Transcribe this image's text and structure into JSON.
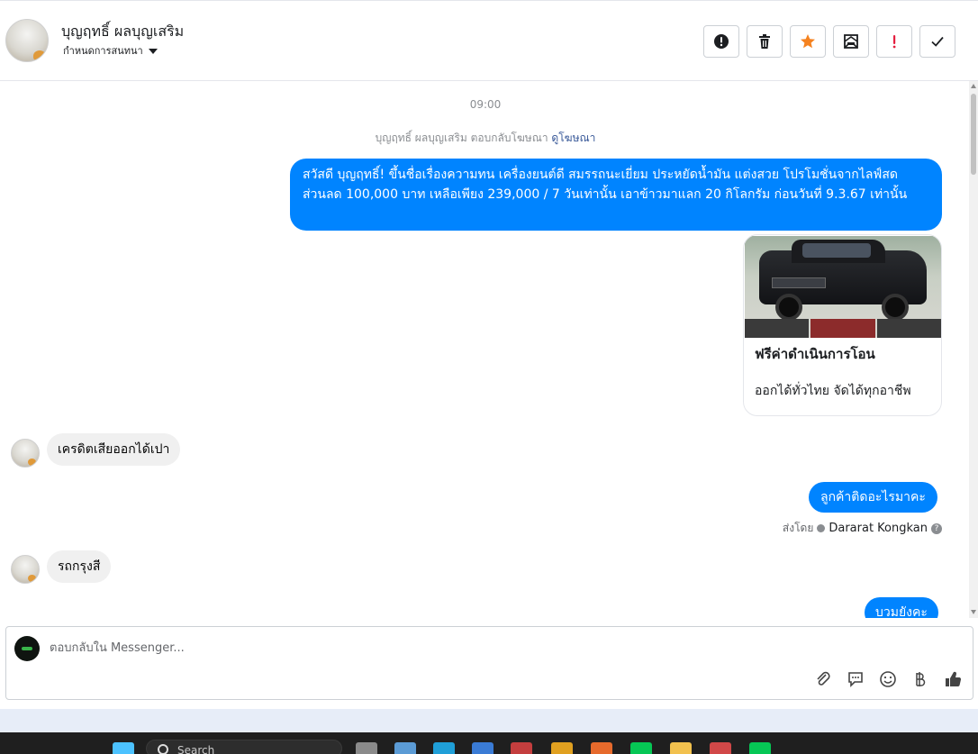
{
  "header": {
    "contact_name": "บุญฤทธิ์ ผลบุญเสริม",
    "assign_label": "กำหนดการสนทนา",
    "toolbar": [
      {
        "name": "spam-button",
        "icon": "alert-circle-icon"
      },
      {
        "name": "delete-button",
        "icon": "trash-icon"
      },
      {
        "name": "star-button",
        "icon": "star-icon",
        "color": "#f5821f"
      },
      {
        "name": "mark-unread-button",
        "icon": "envelope-icon"
      },
      {
        "name": "follow-up-button",
        "icon": "exclamation-icon",
        "color": "#e41e3f"
      },
      {
        "name": "mark-done-button",
        "icon": "check-icon"
      }
    ]
  },
  "conversation": {
    "timestamp": "09:00",
    "ad_reply_prefix": "บุญฤทธิ์ ผลบุญเสริม ตอบกลับโฆษณา",
    "ad_reply_link": "ดูโฆษณา",
    "ad_message": "สวัสดี บุญฤทธิ์! ขึ้นชื่อเรื่องความทน เครื่องยนต์ดี สมรรถนะเยี่ยม ประหยัดน้ำมัน แต่งสวย โปรโมชั่นจากไลฟ์สด ส่วนลด 100,000 บาท เหลือเพียง 239,000 / 7 วันเท่านั้น เอาข้าวมาแลก 20 กิโลกรัม ก่อนวันที่ 9.3.67 เท่านั้น",
    "ad_card": {
      "title": "ฟรีค่าดำเนินการโอน",
      "subtitle": "ออกได้ทั่วไทย จัดได้ทุกอาชีพ"
    },
    "incoming_1": "เครดิตเสียออกได้เปา",
    "outgoing_1": "ลูกค้าติดอะไรมาคะ",
    "sent_by_label": "ส่งโดย",
    "sent_by_name": "Dararat Kongkan",
    "incoming_2": "รถกรุงสี",
    "outgoing_2_partial": "บวมยังคะ"
  },
  "composer": {
    "placeholder": "ตอบกลับใน Messenger...",
    "icons": [
      "paperclip-icon",
      "saved-reply-icon",
      "emoji-icon",
      "baht-icon",
      "thumbs-up-icon"
    ]
  },
  "taskbar": {
    "search_label": "Search"
  },
  "colors": {
    "outgoing_bubble": "#0084ff",
    "incoming_bubble": "#f0f0f0",
    "accent_link": "#385898"
  }
}
